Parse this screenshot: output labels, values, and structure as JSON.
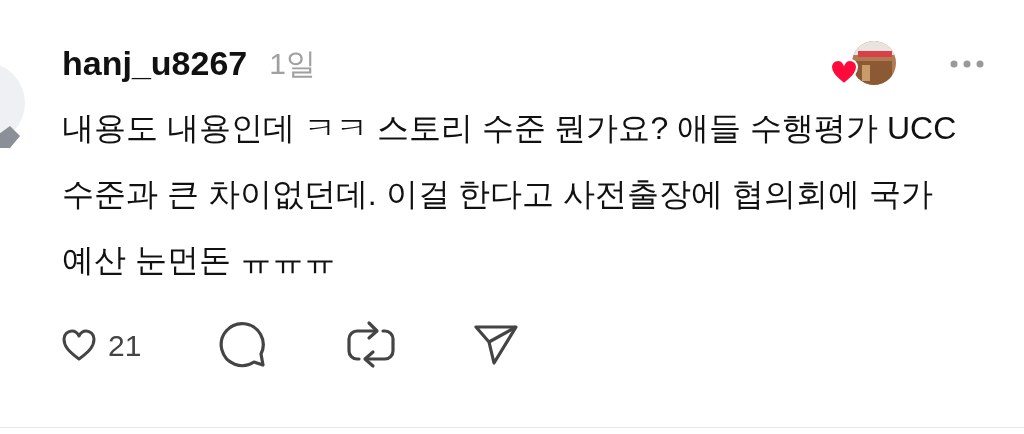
{
  "post": {
    "username": "hanj_u8267",
    "time": "1일",
    "text": "내용도 내용인데 ㅋㅋ 스토리 수준 뭔가요? 애들 수행평가 UCC 수준과 큰 차이없던데. 이걸 한다고 사전출장에 협의회에 국가예산 눈먼돈 ㅠㅠㅠ",
    "author_liked": true,
    "likes": "21"
  }
}
